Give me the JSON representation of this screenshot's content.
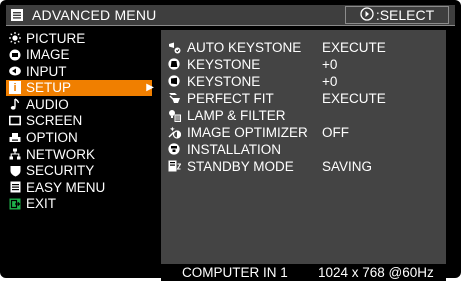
{
  "title": {
    "label": "ADVANCED MENU",
    "icon": "menu-list-icon"
  },
  "select_hint": {
    "label": ":SELECT",
    "icon": "select-button-icon"
  },
  "menu": [
    {
      "label": "PICTURE",
      "icon": "brightness-icon",
      "selected": false
    },
    {
      "label": "IMAGE",
      "icon": "image-icon",
      "selected": false
    },
    {
      "label": "INPUT",
      "icon": "input-icon",
      "selected": false
    },
    {
      "label": "SETUP",
      "icon": "setup-icon",
      "selected": true
    },
    {
      "label": "AUDIO",
      "icon": "music-note-icon",
      "selected": false
    },
    {
      "label": "SCREEN",
      "icon": "screen-icon",
      "selected": false
    },
    {
      "label": "OPTION",
      "icon": "option-icon",
      "selected": false
    },
    {
      "label": "NETWORK",
      "icon": "network-icon",
      "selected": false
    },
    {
      "label": "SECURITY",
      "icon": "shield-icon",
      "selected": false
    },
    {
      "label": "EASY MENU",
      "icon": "easy-menu-icon",
      "selected": false
    },
    {
      "label": "EXIT",
      "icon": "exit-icon",
      "selected": false
    }
  ],
  "setup_items": [
    {
      "label": "AUTO KEYSTONE",
      "value": "EXECUTE",
      "icon": "auto-keystone-icon"
    },
    {
      "label": "KEYSTONE",
      "value": "+0",
      "icon": "keystone-vertical-icon"
    },
    {
      "label": "KEYSTONE",
      "value": "+0",
      "icon": "keystone-horizontal-icon"
    },
    {
      "label": "PERFECT FIT",
      "value": "EXECUTE",
      "icon": "perfect-fit-icon"
    },
    {
      "label": "LAMP & FILTER",
      "value": "",
      "icon": "lamp-filter-icon"
    },
    {
      "label": "IMAGE OPTIMIZER",
      "value": "OFF",
      "icon": "image-optimizer-icon"
    },
    {
      "label": "INSTALLATION",
      "value": "",
      "icon": "installation-icon"
    },
    {
      "label": "STANDBY MODE",
      "value": "SAVING",
      "icon": "standby-icon"
    }
  ],
  "status": {
    "source": "COMPUTER IN 1",
    "resolution": "1024 x 768 @60Hz"
  },
  "colors": {
    "accent": "#f07f00",
    "panel": "#444444",
    "titlebar": "#3e3e3e",
    "exit_green": "#1fb04a"
  }
}
